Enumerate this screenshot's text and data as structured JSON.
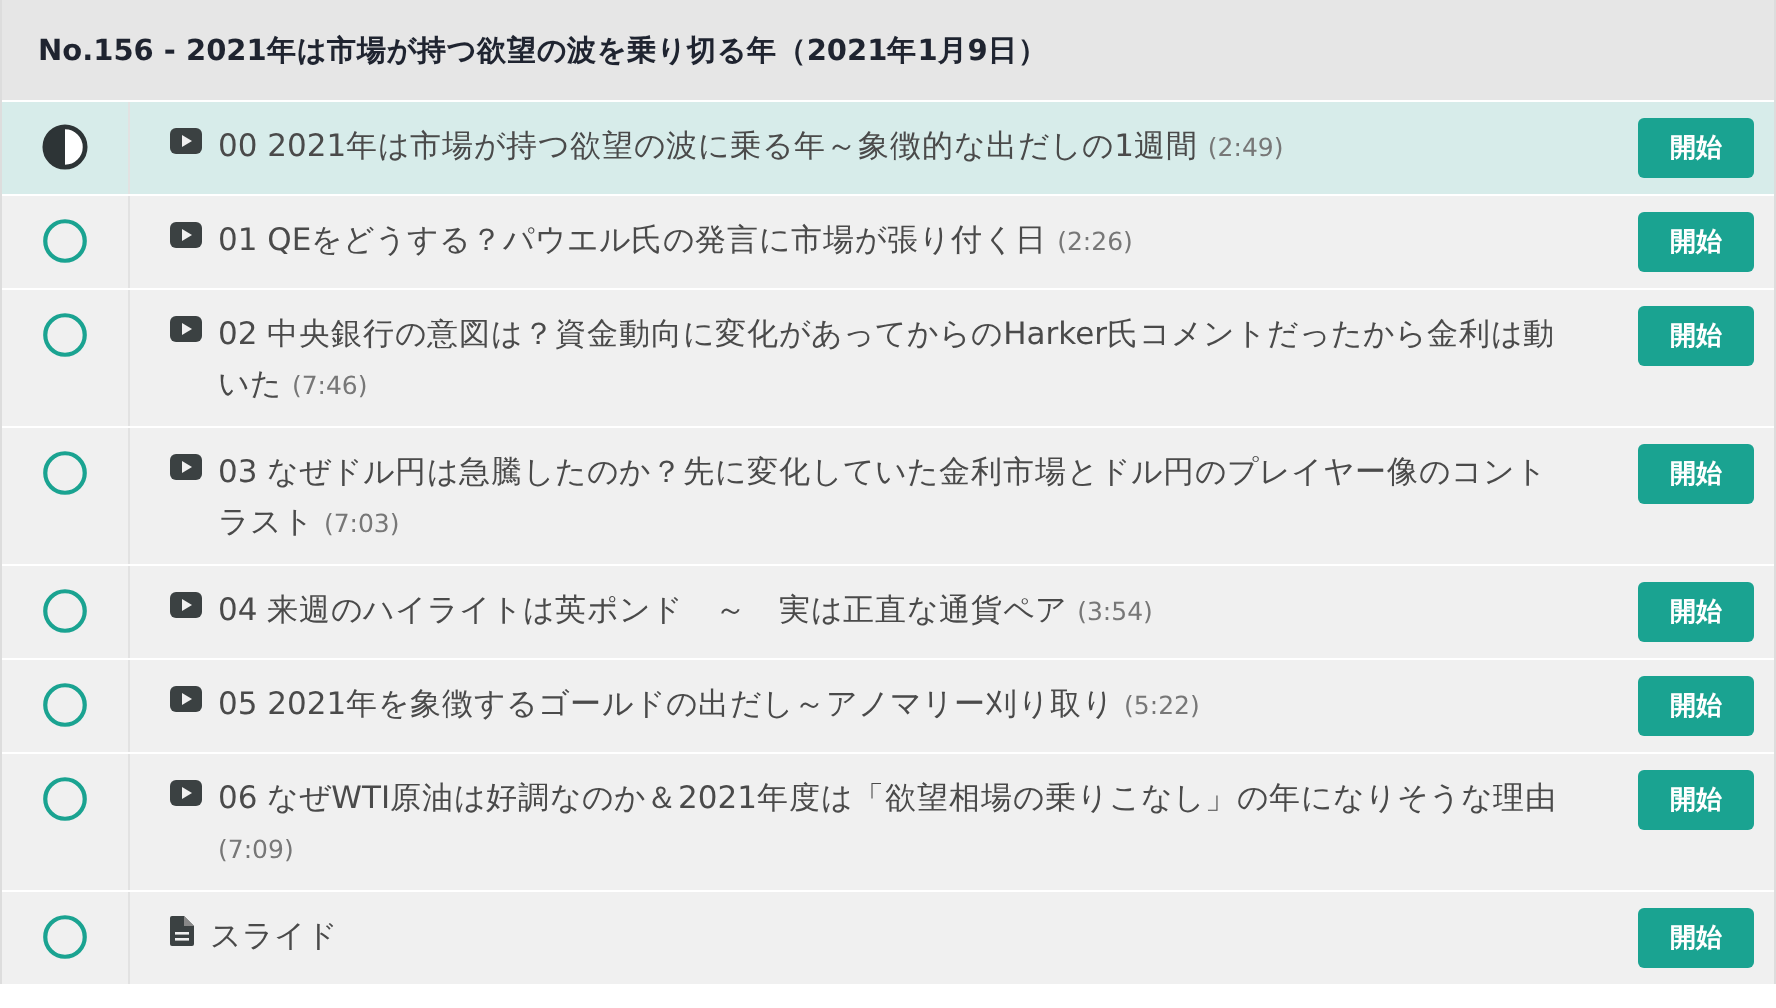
{
  "header": {
    "title": "No.156 - 2021年は市場が持つ欲望の波を乗り切る年（2021年1月9日）"
  },
  "lessons": [
    {
      "kind": "video",
      "in_progress": true,
      "current": true,
      "title": "00 2021年は市場が持つ欲望の波に乗る年～象徴的な出だしの1週間",
      "duration": "(2:49)",
      "button": "開始"
    },
    {
      "kind": "video",
      "in_progress": false,
      "current": false,
      "title": "01 QEをどうする？パウエル氏の発言に市場が張り付く日",
      "duration": "(2:26)",
      "button": "開始"
    },
    {
      "kind": "video",
      "in_progress": false,
      "current": false,
      "title": "02 中央銀行の意図は？資金動向に変化があってからのHarker氏コメントだったから金利は動いた",
      "duration": "(7:46)",
      "button": "開始"
    },
    {
      "kind": "video",
      "in_progress": false,
      "current": false,
      "title": "03 なぜドル円は急騰したのか？先に変化していた金利市場とドル円のプレイヤー像のコントラスト",
      "duration": "(7:03)",
      "button": "開始"
    },
    {
      "kind": "video",
      "in_progress": false,
      "current": false,
      "title": "04 来週のハイライトは英ポンド　～　実は正直な通貨ペア",
      "duration": "(3:54)",
      "button": "開始"
    },
    {
      "kind": "video",
      "in_progress": false,
      "current": false,
      "title": "05 2021年を象徴するゴールドの出だし～アノマリー刈り取り",
      "duration": "(5:22)",
      "button": "開始"
    },
    {
      "kind": "video",
      "in_progress": false,
      "current": false,
      "title": "06 なぜWTI原油は好調なのか＆2021年度は「欲望相場の乗りこなし」の年になりそうな理由",
      "duration": "(7:09)",
      "button": "開始"
    },
    {
      "kind": "document",
      "in_progress": false,
      "current": false,
      "title": "スライド",
      "button": "開始"
    }
  ]
}
